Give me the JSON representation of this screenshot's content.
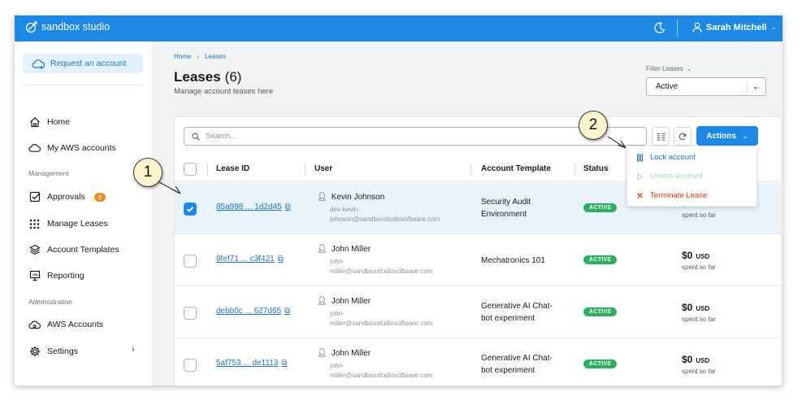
{
  "app": {
    "brand": "sandbox studio"
  },
  "header": {
    "user_name": "Sarah Mitchell"
  },
  "sidebar": {
    "request_button": "Request an account",
    "items": [
      {
        "label": "Home"
      },
      {
        "label": "My AWS accounts"
      }
    ],
    "section_management": "Management",
    "management_items": [
      {
        "label": "Approvals",
        "badge": "3"
      },
      {
        "label": "Manage Leases"
      },
      {
        "label": "Account Templates"
      },
      {
        "label": "Reporting"
      }
    ],
    "section_administration": "Administration",
    "admin_items": [
      {
        "label": "AWS Accounts"
      },
      {
        "label": "Settings"
      }
    ]
  },
  "breadcrumb": {
    "home": "Home",
    "sep": "›",
    "current": "Leases"
  },
  "page": {
    "title": "Leases",
    "count": "(6)",
    "subtitle": "Manage account leases here"
  },
  "filter": {
    "label": "Filter Leases",
    "value": "Active"
  },
  "search": {
    "placeholder": "Search..."
  },
  "actions": {
    "label": "Actions",
    "menu": [
      {
        "label": "Lock account",
        "color": "#1e73be",
        "enabled": true
      },
      {
        "label": "Unlock account",
        "color": "#a8d5b0",
        "enabled": false
      },
      {
        "label": "Terminate Lease",
        "color": "#d13212",
        "enabled": true
      }
    ]
  },
  "table": {
    "headers": {
      "lease_id": "Lease ID",
      "user": "User",
      "template": "Account Template",
      "status": "Status"
    },
    "rows": [
      {
        "lease_id": "85a998 ... 1d2d45",
        "user": "Kevin Johnson",
        "email_1": "dev-kevin-",
        "email_2": "johnson@sandboxstudiosoftware.com",
        "template_1": "Security Audit",
        "template_2": "Environment",
        "status": "ACTIVE",
        "cost": "$0",
        "currency": "USD",
        "spent": "spent so far",
        "selected": true
      },
      {
        "lease_id": "8fef71 ... c3f421",
        "user": "John Miller",
        "email_1": "john-",
        "email_2": "miller@sandboxstudiosoftware.com",
        "template_1": "Mechatronics 101",
        "template_2": "",
        "status": "ACTIVE",
        "cost": "$0",
        "currency": "USD",
        "spent": "spent so far",
        "selected": false
      },
      {
        "lease_id": "debb0c ... 627d65",
        "user": "John Miller",
        "email_1": "john-",
        "email_2": "miller@sandboxstudiosoftware.com",
        "template_1": "Generative AI Chat-",
        "template_2": "bot experiment",
        "status": "ACTIVE",
        "cost": "$0",
        "currency": "USD",
        "spent": "spent so far",
        "selected": false
      },
      {
        "lease_id": "5af753 ... de1113",
        "user": "John Miller",
        "email_1": "john-",
        "email_2": "miller@sandboxstudiosoftware.com",
        "template_1": "Generative AI Chat-",
        "template_2": "bot experiment",
        "status": "ACTIVE",
        "cost": "$0",
        "currency": "USD",
        "spent": "spent so far",
        "selected": false
      }
    ]
  },
  "callouts": [
    "1",
    "2"
  ],
  "colors": {
    "accent": "#1e88e5",
    "status_active": "#2eae5e",
    "badge": "#f28c28",
    "danger": "#d13212"
  }
}
